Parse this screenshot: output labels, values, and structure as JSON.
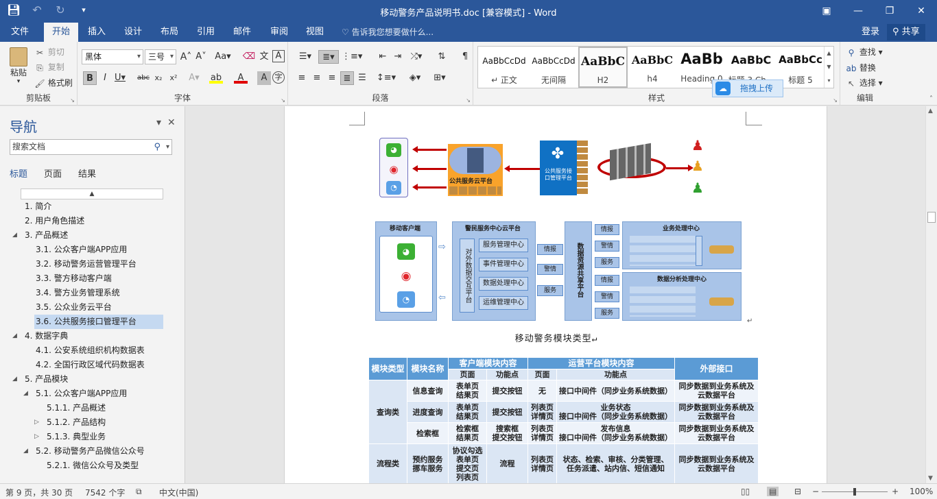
{
  "titlebar": {
    "title": "移动警务产品说明书.doc [兼容模式] - Word"
  },
  "tabs": {
    "items": [
      "文件",
      "开始",
      "插入",
      "设计",
      "布局",
      "引用",
      "邮件",
      "审阅",
      "视图"
    ],
    "tell_me": "告诉我您想要做什么...",
    "login": "登录",
    "share": "共享"
  },
  "ribbon": {
    "clipboard": {
      "paste": "粘贴",
      "cut": "剪切",
      "copy": "复制",
      "format_painter": "格式刷",
      "label": "剪贴板"
    },
    "font": {
      "name": "黑体",
      "size": "三号",
      "label": "字体"
    },
    "paragraph": {
      "label": "段落"
    },
    "styles": {
      "label": "样式",
      "items": [
        {
          "sample": "AaBbCcDd",
          "name": "↵ 正文"
        },
        {
          "sample": "AaBbCcDd",
          "name": "无间隔"
        },
        {
          "sample": "AaBbC",
          "name": "H2"
        },
        {
          "sample": "AaBbC",
          "name": "h4"
        },
        {
          "sample": "AaBb",
          "name": "Heading 0"
        },
        {
          "sample": "AaBbC",
          "name": "标题 3 Ch..."
        },
        {
          "sample": "AaBbCc",
          "name": "标题 5"
        }
      ]
    },
    "editing": {
      "find": "查找",
      "replace": "替换",
      "select": "选择",
      "label": "编辑"
    },
    "upload": "拖拽上传"
  },
  "nav": {
    "title": "导航",
    "search_placeholder": "搜索文档",
    "tabs": [
      "标题",
      "页面",
      "结果"
    ],
    "items": [
      {
        "label": "1. 简介",
        "level": 0,
        "twisty": ""
      },
      {
        "label": "2. 用户角色描述",
        "level": 0,
        "twisty": ""
      },
      {
        "label": "3. 产品概述",
        "level": 0,
        "twisty": "◢"
      },
      {
        "label": "3.1. 公众客户端APP应用",
        "level": 1,
        "twisty": ""
      },
      {
        "label": "3.2. 移动警务运营管理平台",
        "level": 1,
        "twisty": ""
      },
      {
        "label": "3.3. 警方移动客户端",
        "level": 1,
        "twisty": ""
      },
      {
        "label": "3.4. 警方业务管理系统",
        "level": 1,
        "twisty": ""
      },
      {
        "label": "3.5. 公众业务云平台",
        "level": 1,
        "twisty": ""
      },
      {
        "label": "3.6. 公共服务接口管理平台",
        "level": 1,
        "twisty": "",
        "selected": true
      },
      {
        "label": "4. 数据字典",
        "level": 0,
        "twisty": "◢"
      },
      {
        "label": "4.1. 公安系统组织机构数据表",
        "level": 1,
        "twisty": ""
      },
      {
        "label": "4.2. 全国行政区域代码数据表",
        "level": 1,
        "twisty": ""
      },
      {
        "label": "5. 产品模块",
        "level": 0,
        "twisty": "◢"
      },
      {
        "label": "5.1. 公众客户端APP应用",
        "level": 1,
        "twisty": "◢"
      },
      {
        "label": "5.1.1. 产品概述",
        "level": 2,
        "twisty": ""
      },
      {
        "label": "5.1.2. 产品结构",
        "level": 2,
        "twisty": "▷"
      },
      {
        "label": "5.1.3. 典型业务",
        "level": 2,
        "twisty": "▷"
      },
      {
        "label": "5.2. 移动警务产品微信公众号",
        "level": 1,
        "twisty": "◢"
      },
      {
        "label": "5.2.1. 微信公众号及类型",
        "level": 2,
        "twisty": ""
      }
    ]
  },
  "document": {
    "diagram1": {
      "cloud_label": "公共服务云平台",
      "interface_label": "公共服务接口管理平台"
    },
    "diagram2": {
      "mobile_client": "移动客户端",
      "police_cloud": "警民服务中心云平台",
      "external_data": "对外数据交互平台",
      "services": [
        "服务管理中心",
        "事件管理中心",
        "数据处理中心",
        "运维管理中心"
      ],
      "mid_arrows": [
        "情报",
        "警情",
        "服务"
      ],
      "share_platform": "数据资源共享平台",
      "right_arrows": [
        "情报",
        "警情",
        "服务",
        "情报",
        "警情",
        "服务"
      ],
      "biz_center": "业务处理中心",
      "analysis_center": "数据分析处理中心"
    },
    "caption": "移动警务模块类型↵",
    "table": {
      "headers": {
        "type": "模块类型",
        "name": "模块名称",
        "client": "客户端模块内容",
        "ops": "运营平台模块内容",
        "ext": "外部接口",
        "page": "页面",
        "func": "功能点"
      },
      "rows": [
        {
          "type": "查询类",
          "name": "信息查询",
          "cpage": "表单页\n结果页",
          "cfunc": "提交按钮",
          "opage": "无",
          "ofunc": "接口中间件（同步业务系统数据）",
          "ext": "同步数据到业务系统及\n云数据平台"
        },
        {
          "type": "",
          "name": "进度查询",
          "cpage": "表单页\n结果页",
          "cfunc": "提交按钮",
          "opage": "列表页\n详情页",
          "ofunc": "业务状态\n接口中间件（同步业务系统数据）",
          "ext": "同步数据到业务系统及\n云数据平台"
        },
        {
          "type": "",
          "name": "检索框",
          "cpage": "检索框\n结果页",
          "cfunc": "搜索框\n提交按钮",
          "opage": "列表页\n详情页",
          "ofunc": "发布信息\n接口中间件（同步业务系统数据）",
          "ext": "同步数据到业务系统及\n云数据平台"
        },
        {
          "type": "流程类",
          "name": "预约服务\n挪车服务",
          "cpage": "协议勾选\n表单页\n提交页\n列表页",
          "cfunc": "流程",
          "opage": "列表页\n详情页",
          "ofunc": "状态、检索、审核、分类管理、\n任务派遣、站内信、短信通知",
          "ext": "同步数据到业务系统及\n云数据平台"
        }
      ]
    }
  },
  "status": {
    "page": "第 9 页，共 30 页",
    "words": "7542 个字",
    "lang": "中文(中国)",
    "zoom": "100%"
  },
  "colors": {
    "word_blue": "#2b579a",
    "table_header": "#5b9bd5"
  }
}
